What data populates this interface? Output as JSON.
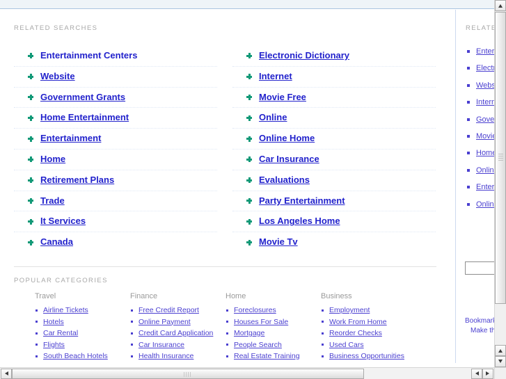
{
  "colors": {
    "link_blue": "#2222cc",
    "small_link": "#4a3fd0",
    "bullet_green": "#119977",
    "label_gray": "#a8a8a8",
    "divider_blue": "#ccd9ef",
    "top_band": "#eef4f8"
  },
  "sections": {
    "related_searches_label": "RELATED SEARCHES",
    "side_related_label": "RELATED",
    "popular_categories_label": "POPULAR CATEGORIES"
  },
  "related_searches": {
    "left_column": [
      {
        "label": "Entertainment Centers",
        "underlined": false
      },
      {
        "label": "Website",
        "underlined": true
      },
      {
        "label": "Government Grants",
        "underlined": true
      },
      {
        "label": "Home Entertainment",
        "underlined": true
      },
      {
        "label": "Entertainment",
        "underlined": true
      },
      {
        "label": "Home",
        "underlined": true
      },
      {
        "label": "Retirement Plans",
        "underlined": true
      },
      {
        "label": "Trade",
        "underlined": true
      },
      {
        "label": "It Services",
        "underlined": true
      },
      {
        "label": "Canada",
        "underlined": true
      }
    ],
    "right_column": [
      {
        "label": "Electronic Dictionary",
        "underlined": true
      },
      {
        "label": "Internet",
        "underlined": true
      },
      {
        "label": "Movie Free",
        "underlined": true
      },
      {
        "label": "Online",
        "underlined": true
      },
      {
        "label": "Online Home",
        "underlined": true
      },
      {
        "label": "Car Insurance",
        "underlined": true
      },
      {
        "label": "Evaluations",
        "underlined": true
      },
      {
        "label": "Party Entertainment",
        "underlined": true
      },
      {
        "label": "Los Angeles Home",
        "underlined": true
      },
      {
        "label": "Movie Tv",
        "underlined": true
      }
    ]
  },
  "popular_categories": [
    {
      "heading": "Travel",
      "items": [
        "Airline Tickets",
        "Hotels",
        "Car Rental",
        "Flights",
        "South Beach Hotels"
      ]
    },
    {
      "heading": "Finance",
      "items": [
        "Free Credit Report",
        "Online Payment",
        "Credit Card Application",
        "Car Insurance",
        "Health Insurance"
      ]
    },
    {
      "heading": "Home",
      "items": [
        "Foreclosures",
        "Houses For Sale",
        "Mortgage",
        "People Search",
        "Real Estate Training"
      ]
    },
    {
      "heading": "Business",
      "items": [
        "Employment",
        "Work From Home",
        "Reorder Checks",
        "Used Cars",
        "Business Opportunities"
      ]
    }
  ],
  "sidebar": {
    "items": [
      "Entertainment Centers",
      "Electronic Dictionary",
      "Website",
      "Internet",
      "Government Grants",
      "Movie Free",
      "Home Entertainment",
      "Online",
      "Entertainment",
      "Online Home"
    ],
    "search_value": "",
    "search_placeholder": "",
    "footer_line1": "Bookmark",
    "footer_line2": "Make this"
  },
  "scrollbars": {
    "vertical_up_icon": "triangle-up-icon",
    "vertical_down_icon": "triangle-down-icon",
    "horizontal_left_icon": "triangle-left-icon",
    "horizontal_right_icon": "triangle-right-icon"
  }
}
